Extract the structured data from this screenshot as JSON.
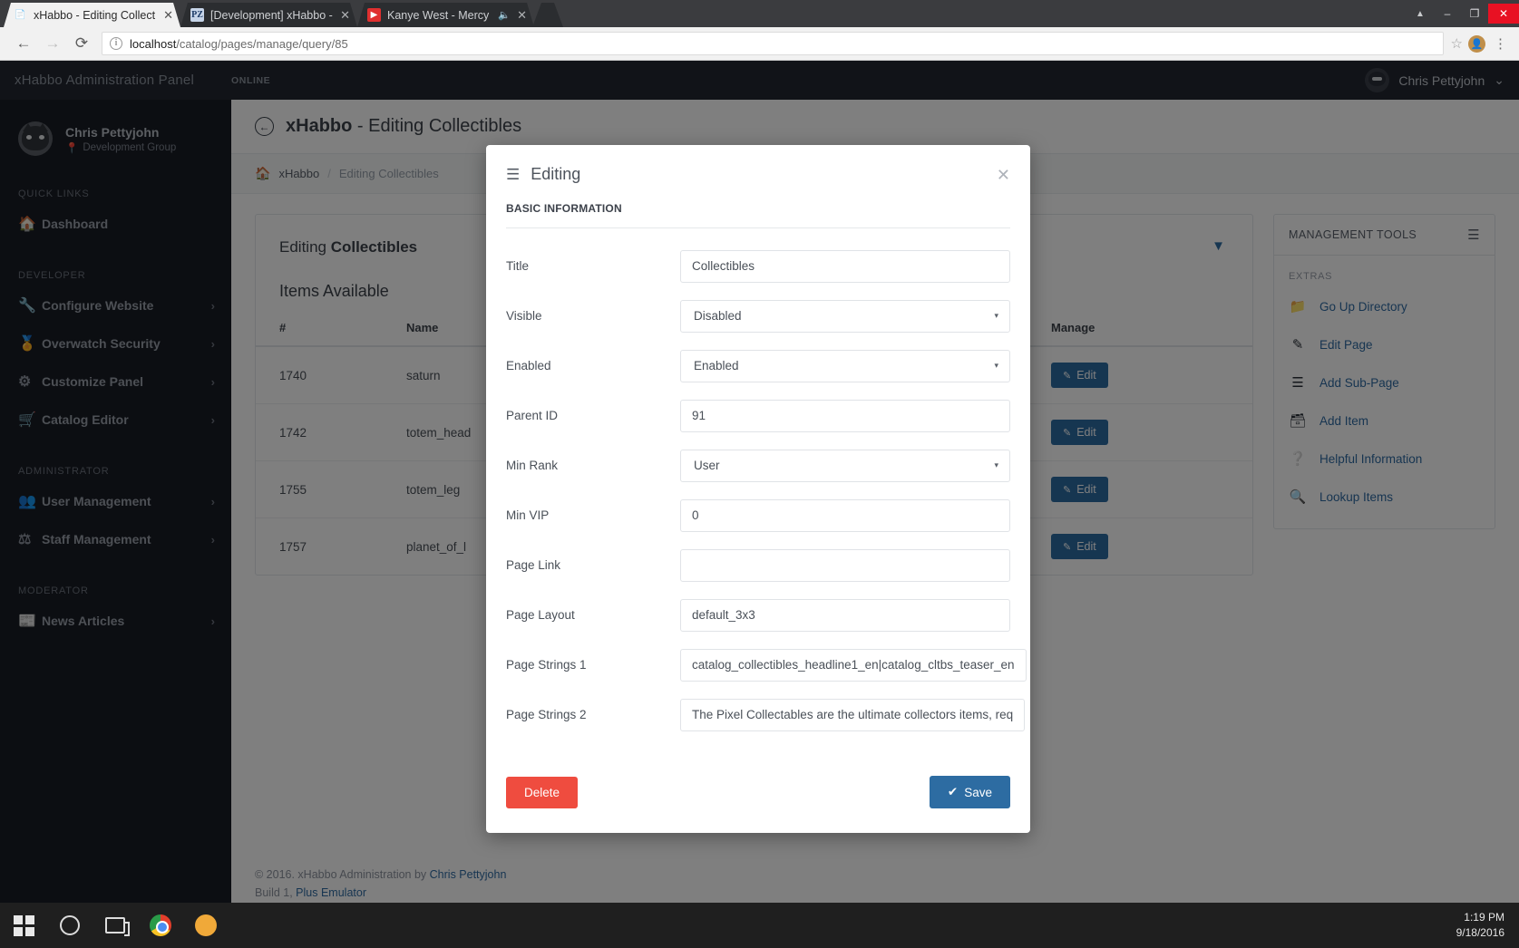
{
  "browser": {
    "tabs": [
      {
        "title": "xHabbo - Editing Collect",
        "favicon": "document-icon",
        "active": true,
        "muted": false
      },
      {
        "title": "[Development] xHabbo -",
        "favicon": "blue-app-icon",
        "active": false,
        "muted": false
      },
      {
        "title": "Kanye West - Mercy (",
        "favicon": "youtube-icon",
        "active": false,
        "muted": true
      }
    ],
    "url_host": "localhost",
    "url_path": "/catalog/pages/manage/query/85",
    "window_controls": {
      "minimize": "–",
      "maximize": "❐",
      "close": "✕",
      "restore_up": "⌃"
    }
  },
  "topbar": {
    "brand": "xHabbo Administration Panel",
    "status": "ONLINE",
    "user_name": "Chris Pettyjohn",
    "user_caret": "⌄"
  },
  "sidebar": {
    "profile": {
      "name": "Chris Pettyjohn",
      "group": "Development Group",
      "pin_icon": "location-pin-icon"
    },
    "sections": [
      {
        "heading": "QUICK LINKS",
        "items": [
          {
            "label": "Dashboard",
            "icon": "home-icon",
            "caret": false
          }
        ]
      },
      {
        "heading": "DEVELOPER",
        "items": [
          {
            "label": "Configure Website",
            "icon": "wrench-icon",
            "caret": true
          },
          {
            "label": "Overwatch Security",
            "icon": "medal-icon",
            "caret": true
          },
          {
            "label": "Customize Panel",
            "icon": "gear-icon",
            "caret": true
          },
          {
            "label": "Catalog Editor",
            "icon": "shopping-cart-icon",
            "caret": true
          }
        ]
      },
      {
        "heading": "ADMINISTRATOR",
        "items": [
          {
            "label": "User Management",
            "icon": "users-icon",
            "caret": true
          },
          {
            "label": "Staff Management",
            "icon": "sitemap-icon",
            "caret": true
          }
        ]
      },
      {
        "heading": "MODERATOR",
        "items": [
          {
            "label": "News Articles",
            "icon": "newspaper-icon",
            "caret": true
          }
        ]
      }
    ],
    "caret_glyph": "›"
  },
  "page": {
    "back_icon": "back-arrow-circle-icon",
    "title_prefix": "xHabbo",
    "title_rest": " - Editing Collectibles",
    "breadcrumb": {
      "home_icon": "home-icon",
      "root": "xHabbo",
      "separator": "/",
      "current": "Editing Collectibles"
    }
  },
  "left_card": {
    "heading_prefix": "Editing ",
    "heading_strong": "Collectibles",
    "collapse_icon": "chevron-down-icon",
    "subheading": "Items Available",
    "columns": [
      "#",
      "Name",
      "Manage"
    ],
    "rows": [
      {
        "id": "1740",
        "name": "saturn",
        "action": "Edit"
      },
      {
        "id": "1742",
        "name": "totem_head",
        "action": "Edit"
      },
      {
        "id": "1755",
        "name": "totem_leg",
        "action": "Edit"
      },
      {
        "id": "1757",
        "name": "planet_of_l",
        "action": "Edit"
      }
    ],
    "edit_icon": "pencil-icon"
  },
  "right_card": {
    "title": "MANAGEMENT TOOLS",
    "menu_icon": "hamburger-icon",
    "section_label": "EXTRAS",
    "items": [
      {
        "label": "Go Up Directory",
        "icon": "folder-icon"
      },
      {
        "label": "Edit Page",
        "icon": "pencil-icon"
      },
      {
        "label": "Add Sub-Page",
        "icon": "layers-icon"
      },
      {
        "label": "Add Item",
        "icon": "database-icon"
      },
      {
        "label": "Helpful Information",
        "icon": "question-circle-icon"
      },
      {
        "label": "Lookup Items",
        "icon": "search-icon"
      }
    ]
  },
  "footer": {
    "copyright": "© 2016. xHabbo Administration by ",
    "author": "Chris Pettyjohn",
    "build_prefix": "Build 1, ",
    "build_link": "Plus Emulator"
  },
  "modal": {
    "menu_icon": "hamburger-icon",
    "title": "Editing",
    "close_icon": "close-icon",
    "section_title": "BASIC INFORMATION",
    "fields": [
      {
        "label": "Title",
        "value": "Collectibles",
        "type": "text"
      },
      {
        "label": "Visible",
        "value": "Disabled",
        "type": "select"
      },
      {
        "label": "Enabled",
        "value": "Enabled",
        "type": "select"
      },
      {
        "label": "Parent ID",
        "value": "91",
        "type": "text"
      },
      {
        "label": "Min Rank",
        "value": "User",
        "type": "select"
      },
      {
        "label": "Min VIP",
        "value": "0",
        "type": "text"
      },
      {
        "label": "Page Link",
        "value": "",
        "type": "text"
      },
      {
        "label": "Page Layout",
        "value": "default_3x3",
        "type": "text"
      },
      {
        "label": "Page Strings 1",
        "value": "catalog_collectibles_headline1_en|catalog_cltbs_teaser_en",
        "type": "text"
      },
      {
        "label": "Page Strings 2",
        "value": "The Pixel Collectables are the ultimate collectors items, req",
        "type": "text"
      }
    ],
    "select_arrow": "▾",
    "delete_label": "Delete",
    "save_label": "Save",
    "save_icon": "✔"
  },
  "taskbar": {
    "start_icon": "windows-logo-icon",
    "search_icon": "cortana-circle-icon",
    "taskview_icon": "task-view-icon",
    "apps": [
      "chrome-icon",
      "duck-icon"
    ],
    "time": "1:19 PM",
    "date": "9/18/2016"
  },
  "colors": {
    "accent_blue": "#2d6ca2",
    "danger_red": "#ef4c3f",
    "sidebar_dark": "#191d24",
    "topbar_dark": "#232730"
  }
}
